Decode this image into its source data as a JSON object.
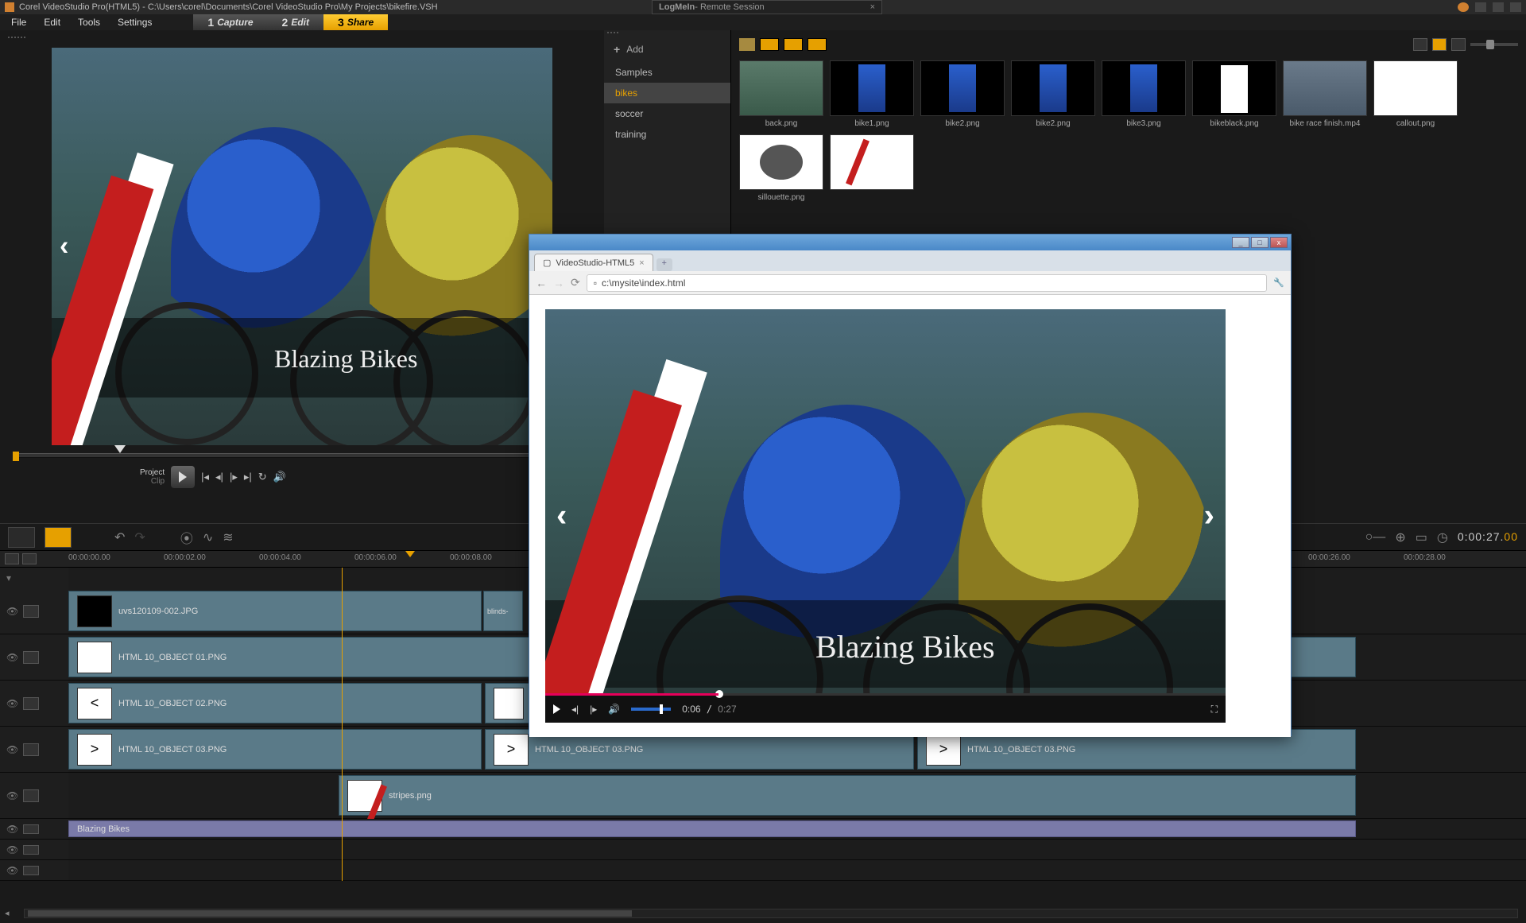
{
  "titlebar": {
    "app": "Corel VideoStudio Pro(HTML5)",
    "path": "C:\\Users\\corel\\Documents\\Corel VideoStudio Pro\\My Projects\\bikefire.VSH"
  },
  "logmein": {
    "brand": "LogMeIn",
    "suffix": " - Remote Session"
  },
  "menus": [
    "File",
    "Edit",
    "Tools",
    "Settings"
  ],
  "steps": [
    {
      "n": "1",
      "label": "Capture"
    },
    {
      "n": "2",
      "label": "Edit"
    },
    {
      "n": "3",
      "label": "Share"
    }
  ],
  "preview": {
    "title_text": "Blazing Bikes",
    "mode_project": "Project",
    "mode_clip": "Clip"
  },
  "library": {
    "add": "Add",
    "cats": [
      "Samples",
      "bikes",
      "soccer",
      "training"
    ],
    "selected": "bikes",
    "thumbs": [
      {
        "name": "back.png",
        "cls": "th-back"
      },
      {
        "name": "bike1.png",
        "cls": "th-bike1"
      },
      {
        "name": "bike2.png",
        "cls": "th-bike2"
      },
      {
        "name": "bike2.png",
        "cls": "th-bike2b"
      },
      {
        "name": "bike3.png",
        "cls": "th-bike3"
      },
      {
        "name": "bikeblack.png",
        "cls": "th-black"
      },
      {
        "name": "bike race finish.mp4",
        "cls": "th-race"
      },
      {
        "name": "callout.png",
        "cls": "th-callout"
      },
      {
        "name": "sillouette.png",
        "cls": "th-sil"
      },
      {
        "name": "",
        "cls": "th-stripe"
      }
    ]
  },
  "ruler": {
    "t0": "00:00:00.00",
    "t1": "00:00:02.00",
    "t2": "00:00:04.00",
    "t3": "00:00:06.00",
    "t4": "00:00:08.00",
    "t5": "00:00:26.00",
    "t6": "00:00:28.00"
  },
  "timecode": {
    "main": "0:00:27.",
    "ms": "00"
  },
  "tracks": {
    "v1": "uvs120109-002.JPG",
    "v1b": "blinds-",
    "o1": "HTML 10_OBJECT 01.PNG",
    "o2": "HTML 10_OBJECT 02.PNG",
    "o3a": "HTML 10_OBJECT 03.PNG",
    "o3b": "HTML 10_OBJECT 03.PNG",
    "o3c": "HTML 10_OBJECT 03.PNG",
    "stripes": "stripes.png",
    "title": "Blazing Bikes"
  },
  "browser": {
    "tab": "VideoStudio-HTML5",
    "url": "c:\\mysite\\index.html",
    "title_text": "Blazing Bikes",
    "cur": "0:06",
    "dur": "0:27"
  }
}
